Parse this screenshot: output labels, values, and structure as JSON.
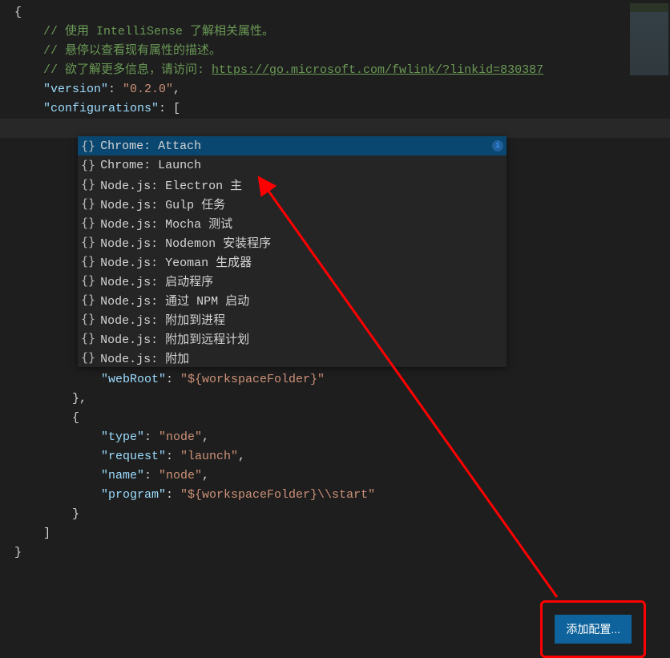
{
  "comments": {
    "c1": "// 使用 IntelliSense 了解相关属性。",
    "c2": "// 悬停以查看现有属性的描述。",
    "c3_prefix": "// 欲了解更多信息，请访问: ",
    "c3_link": "https://go.microsoft.com/fwlink/?linkid=830387"
  },
  "json_keys": {
    "version": "\"version\"",
    "version_val": "\"0.2.0\"",
    "configurations": "\"configurations\"",
    "webRoot": "\"webRoot\"",
    "webRoot_val": "\"${workspaceFolder}\"",
    "type": "\"type\"",
    "type_val": "\"node\"",
    "request": "\"request\"",
    "request_val": "\"launch\"",
    "name": "\"name\"",
    "name_val": "\"node\"",
    "program": "\"program\"",
    "program_val": "\"${workspaceFolder}\\\\start\""
  },
  "braces": {
    "open": "{",
    "close": "}",
    "open_bracket": "[",
    "close_bracket": "]",
    "colon_space": ": ",
    "comma": ","
  },
  "suggest": {
    "icon": "{}",
    "info": "i",
    "items": [
      "Chrome: Attach",
      "Chrome: Launch",
      "Node.js: Electron 主",
      "Node.js: Gulp 任务",
      "Node.js: Mocha 测试",
      "Node.js: Nodemon 安装程序",
      "Node.js: Yeoman 生成器",
      "Node.js: 启动程序",
      "Node.js: 通过 NPM 启动",
      "Node.js: 附加到进程",
      "Node.js: 附加到远程计划",
      "Node.js: 附加"
    ]
  },
  "button": {
    "add_config": "添加配置..."
  }
}
